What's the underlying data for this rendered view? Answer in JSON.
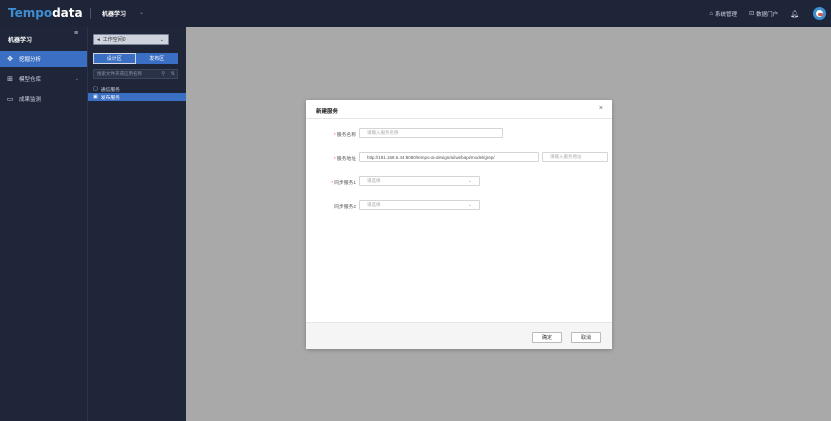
{
  "topbar": {
    "logo_main": "Tempo",
    "logo_suffix": "data",
    "menu_label": "机器学习",
    "menu_chevron": "⌄",
    "right_items": [
      {
        "icon": "home-icon",
        "glyph": "⌂",
        "label": "系统管理"
      },
      {
        "icon": "portal-icon",
        "glyph": "⊡",
        "label": "数据门户"
      }
    ],
    "bell_icon": "bell-icon"
  },
  "sidebar": {
    "title": "机器学习",
    "toggle_icon": "menu-icon",
    "items": [
      {
        "icon": "analysis-icon",
        "glyph": "✥",
        "label": "挖掘分析",
        "active": true
      },
      {
        "icon": "model-icon",
        "glyph": "⊞",
        "label": "模型仓库",
        "arrow": "⌄",
        "active": false
      },
      {
        "icon": "monitor-icon",
        "glyph": "▭",
        "label": "成果监测",
        "active": false
      }
    ]
  },
  "panel2": {
    "workspace_select": "工作空间0",
    "workspace_chevron": "⌄",
    "seg_tabs": [
      "设计区",
      "发布区"
    ],
    "search_placeholder": "搜索文件夹或应用名称",
    "tree": [
      {
        "icon": "folder-icon",
        "glyph": "▢",
        "label": "通信服务",
        "active": false
      },
      {
        "icon": "file-icon",
        "glyph": "▣",
        "label": "发布服务",
        "active": true
      }
    ]
  },
  "dialog": {
    "title": "新建服务",
    "close": "×",
    "fields": [
      {
        "label": "服务名称",
        "required": true,
        "value": "",
        "placeholder": "请输入服务名称"
      },
      {
        "label": "服务地址",
        "required": true,
        "value": "http://191.168.6.44:8080/tempo-ai-design/ai/webapi/model/grep/",
        "placeholder": "请输入服务地址"
      },
      {
        "label": "同步服务1",
        "required": true,
        "value": "",
        "placeholder": "请选择"
      },
      {
        "label": "同步服务2",
        "required": false,
        "value": "",
        "placeholder": "请选择"
      }
    ],
    "ok_label": "确定",
    "cancel_label": "取消"
  }
}
